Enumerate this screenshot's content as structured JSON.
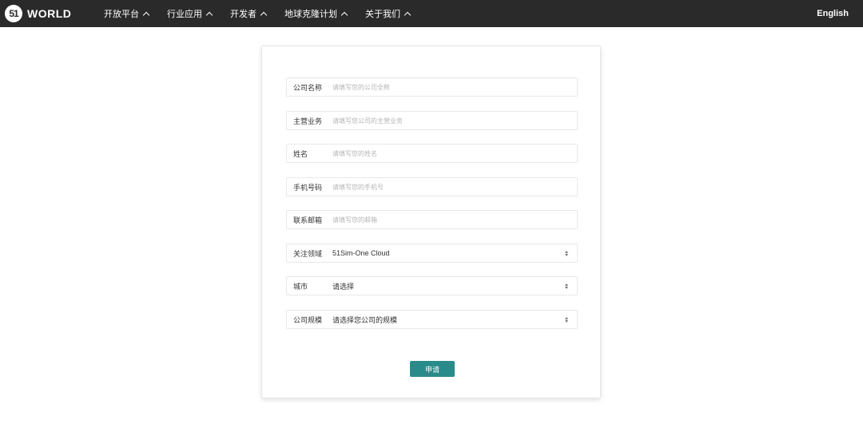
{
  "header": {
    "logo_mark": "51",
    "logo_text": "WORLD",
    "nav": [
      {
        "label": "开放平台"
      },
      {
        "label": "行业应用"
      },
      {
        "label": "开发者"
      },
      {
        "label": "地球克隆计划"
      },
      {
        "label": "关于我们"
      }
    ],
    "language": "English"
  },
  "form": {
    "fields": [
      {
        "label": "公司名称",
        "placeholder": "请填写您的公司全称"
      },
      {
        "label": "主营业务",
        "placeholder": "请填写您公司的主营业务"
      },
      {
        "label": "姓名",
        "placeholder": "请填写您的姓名"
      },
      {
        "label": "手机号码",
        "placeholder": "请填写您的手机号"
      },
      {
        "label": "联系邮箱",
        "placeholder": "请填写您的邮箱"
      }
    ],
    "selects": [
      {
        "label": "关注领域",
        "value": "51Sim-One Cloud"
      },
      {
        "label": "城市",
        "value": "请选择"
      },
      {
        "label": "公司规模",
        "value": "请选择您公司的规模"
      }
    ],
    "submit_label": "申请"
  },
  "colors": {
    "header_bg": "#2a2a2a",
    "accent": "#2a8c8a"
  }
}
